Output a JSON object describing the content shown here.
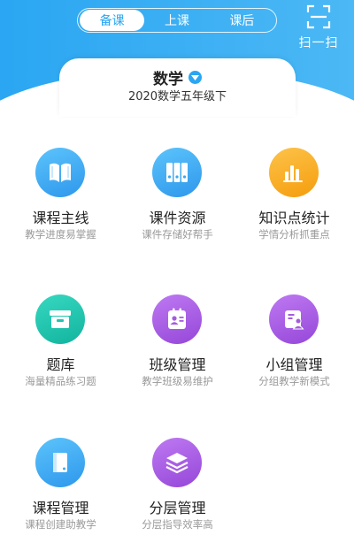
{
  "tabs": [
    {
      "label": "备课",
      "active": true
    },
    {
      "label": "上课",
      "active": false
    },
    {
      "label": "课后",
      "active": false
    }
  ],
  "scan": {
    "label": "扫一扫",
    "icon": "scan-icon"
  },
  "subject": {
    "name": "数学",
    "grade_label": "2020数学五年级下"
  },
  "colors": {
    "header": "#2aa6f2",
    "active_tab_text": "#2aa6f2"
  },
  "menu": [
    {
      "title": "课程主线",
      "desc": "教学进度易掌握",
      "icon": "book-icon",
      "color": "#3da8f0"
    },
    {
      "title": "课件资源",
      "desc": "课件存储好帮手",
      "icon": "binders-icon",
      "color": "#3da8f0"
    },
    {
      "title": "知识点统计",
      "desc": "学情分析抓重点",
      "icon": "bar-chart-icon",
      "color": "#f8ae1c"
    },
    {
      "title": "题库",
      "desc": "海量精品练习题",
      "icon": "archive-box-icon",
      "color": "#20c5b0"
    },
    {
      "title": "班级管理",
      "desc": "教学班级易维护",
      "icon": "class-card-icon",
      "color": "#a55be0"
    },
    {
      "title": "小组管理",
      "desc": "分组教学新模式",
      "icon": "group-card-icon",
      "color": "#a55be0"
    },
    {
      "title": "课程管理",
      "desc": "课程创建助教学",
      "icon": "notebook-icon",
      "color": "#3da8f0"
    },
    {
      "title": "分层管理",
      "desc": "分层指导效率高",
      "icon": "layers-icon",
      "color": "#a55be0"
    }
  ]
}
